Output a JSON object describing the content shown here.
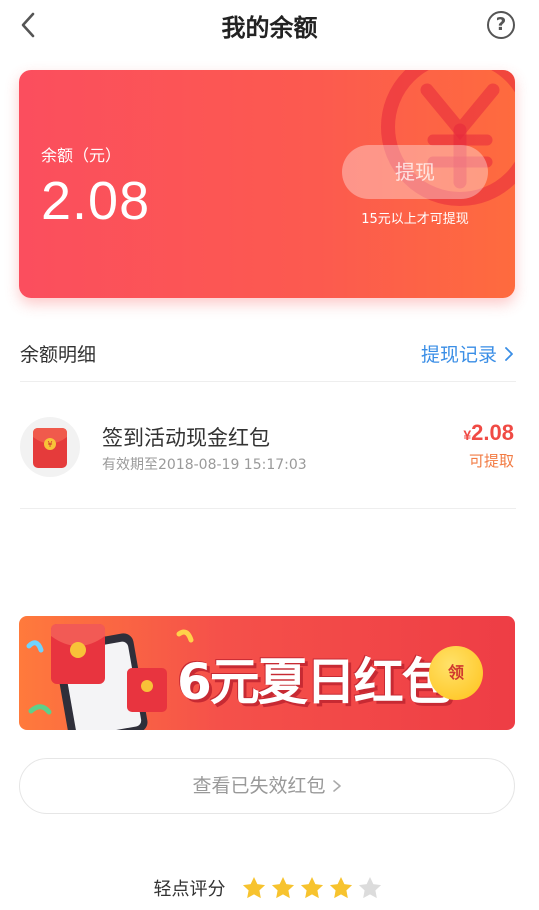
{
  "header": {
    "title": "我的余额",
    "back_icon": "chevron-left-icon",
    "help_icon": "question-circle-icon",
    "help_label": "?"
  },
  "balance_card": {
    "label": "余额（元）",
    "amount": "2.08",
    "withdraw_label": "提现",
    "withdraw_tip": "15元以上才可提现"
  },
  "details": {
    "title": "余额明细",
    "record_link": "提现记录"
  },
  "items": [
    {
      "title": "签到活动现金红包",
      "subtitle": "有效期至2018-08-19 15:17:03",
      "currency": "¥",
      "amount": "2.08",
      "status": "可提取",
      "icon": "red-envelope-icon"
    }
  ],
  "promo": {
    "text": "6元夏日红包",
    "claim_label": "领"
  },
  "expired": {
    "label": "查看已失效红包"
  },
  "rating": {
    "label": "轻点评分",
    "value": 4,
    "max": 5
  },
  "colors": {
    "accent": "#f04a44",
    "link": "#3a8ee6",
    "star_on": "#f7c32e",
    "star_off": "#dcdcdc"
  }
}
